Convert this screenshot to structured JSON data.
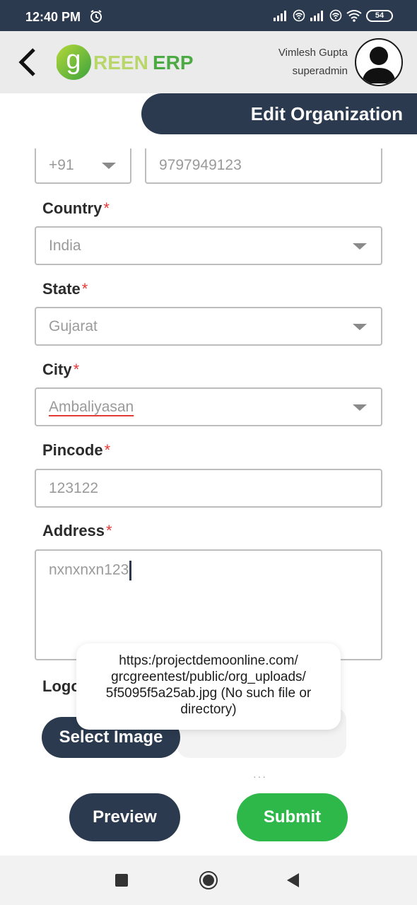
{
  "status_bar": {
    "time": "12:40 PM",
    "battery": "54",
    "icons": [
      "alarm-icon",
      "signal-icon",
      "wifi-calling-icon",
      "signal-icon",
      "wifi-calling-icon",
      "wifi-icon",
      "battery-icon"
    ]
  },
  "header": {
    "logo_letter": "g",
    "logo_text_green": "REEN",
    "logo_text_erp": "ERP",
    "user_name": "Vimlesh Gupta",
    "user_role": "superadmin"
  },
  "page": {
    "title": "Edit Organization"
  },
  "form": {
    "phone": {
      "code": "+91",
      "number": "9797949123"
    },
    "country": {
      "label": "Country",
      "required": "*",
      "value": "India"
    },
    "state": {
      "label": "State",
      "required": "*",
      "value": "Gujarat"
    },
    "city": {
      "label": "City",
      "required": "*",
      "value": "Ambaliyasan"
    },
    "pincode": {
      "label": "Pincode",
      "required": "*",
      "value": "123122"
    },
    "address": {
      "label": "Address",
      "required": "*",
      "value": "nxnxnxn123"
    },
    "logo": {
      "label": "Logo"
    }
  },
  "buttons": {
    "select_image": "Select Image",
    "preview": "Preview",
    "submit": "Submit"
  },
  "toast": {
    "message": "https:/projectdemoonline.com/ grcgreentest/public/org_uploads/ 5f5095f5a25ab.jpg (No such file or directory)"
  },
  "colors": {
    "navy": "#2b3a4e",
    "green": "#2fb84a",
    "required": "#e53935"
  }
}
